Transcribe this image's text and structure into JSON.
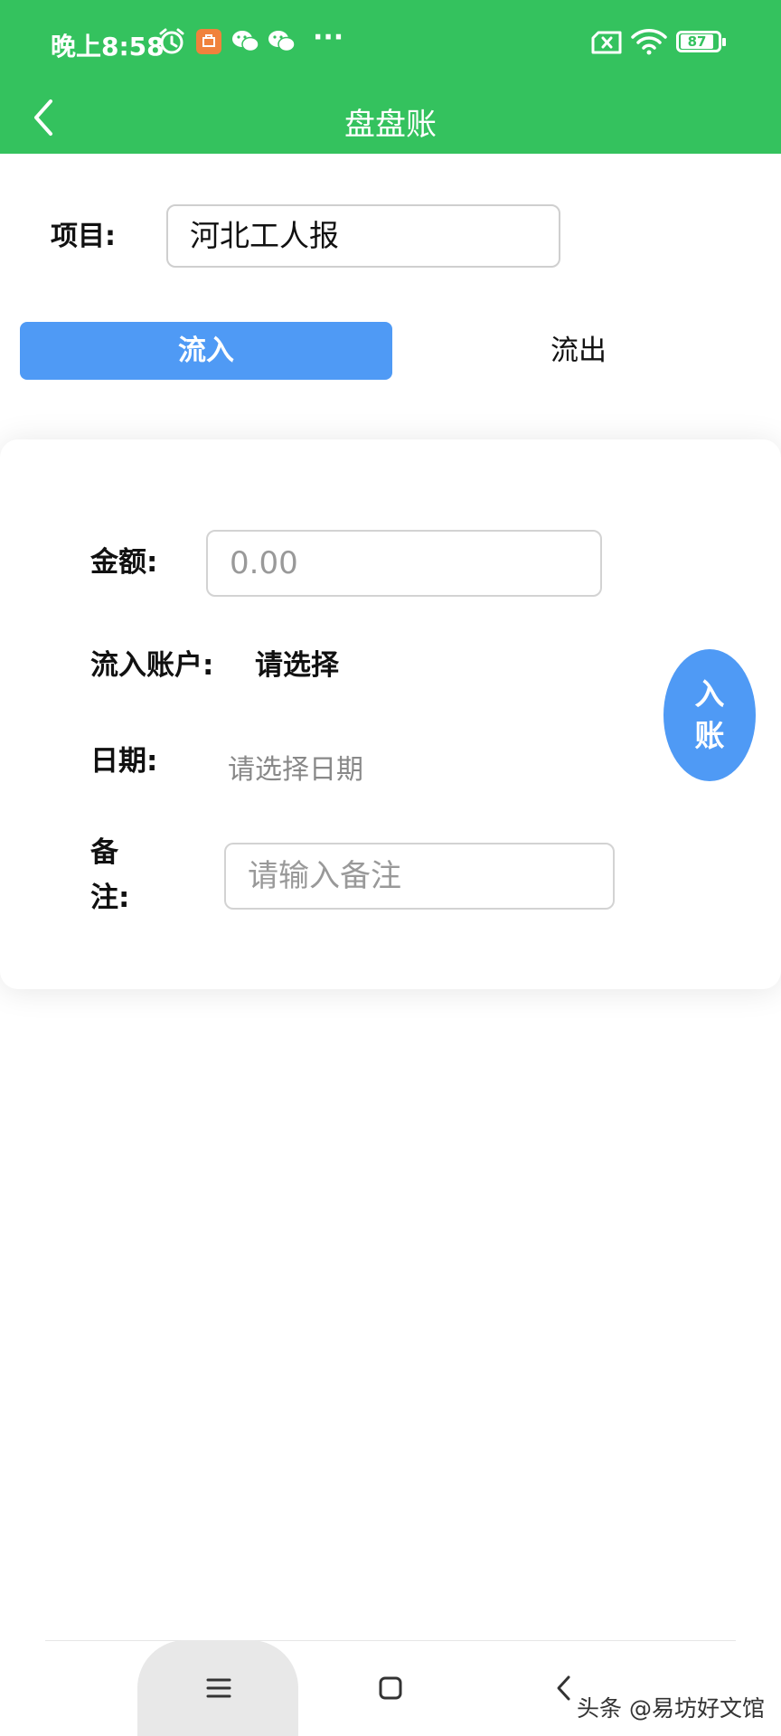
{
  "status_bar": {
    "time": "晚上8:58",
    "battery": "87",
    "icons": [
      "alarm-icon",
      "app-notification-icon",
      "wechat-icon",
      "wechat-icon",
      "more-dots-icon",
      "sim-icon",
      "wifi-icon",
      "battery-icon"
    ],
    "more": "···"
  },
  "header": {
    "title": "盘盘账"
  },
  "project": {
    "label": "项目:",
    "value": "河北工人报"
  },
  "tabs": [
    {
      "label": "流入",
      "active": true
    },
    {
      "label": "流出",
      "active": false
    }
  ],
  "form": {
    "amount_label": "金额:",
    "amount_placeholder": "0.00",
    "account_label": "流入账户:",
    "account_value": "请选择",
    "date_label": "日期:",
    "date_placeholder": "请选择日期",
    "note_label_line1": "备",
    "note_label_line2": "注:",
    "note_placeholder": "请输入备注"
  },
  "fab": {
    "line1": "入",
    "line2": "账"
  },
  "watermark": "头条 @易坊好文馆",
  "colors": {
    "header_bg": "#34c25e",
    "accent": "#4f9af5"
  }
}
